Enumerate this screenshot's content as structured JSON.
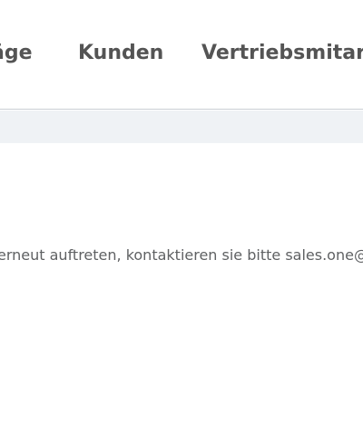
{
  "nav": {
    "items": [
      {
        "label": "äge"
      },
      {
        "label": "Kunden"
      },
      {
        "label": "Vertriebsmitarb"
      }
    ]
  },
  "main": {
    "error_text": "erneut auftreten, kontaktieren sie bitte sales.one@"
  }
}
